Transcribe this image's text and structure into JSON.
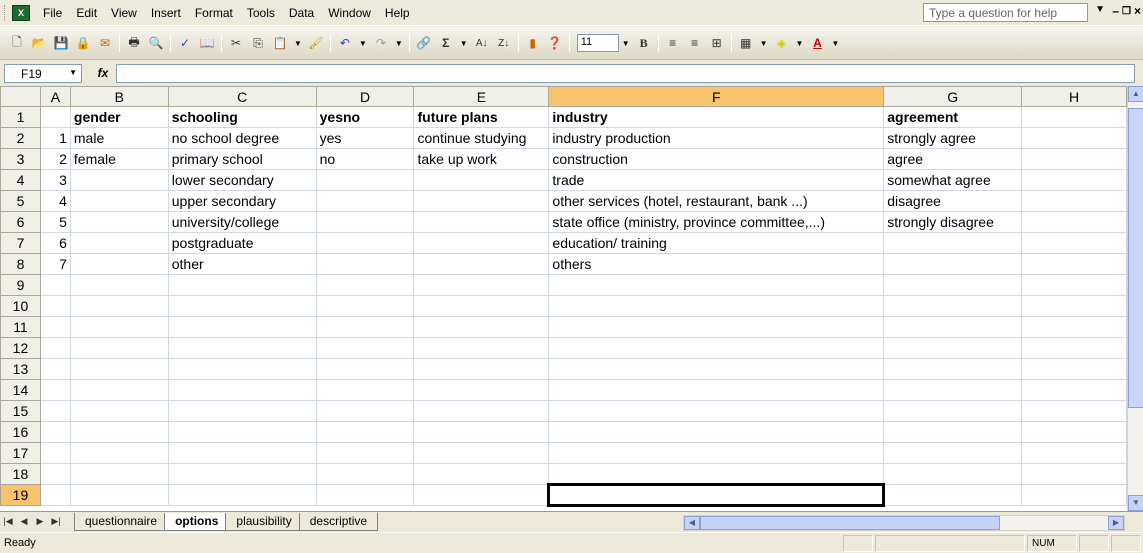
{
  "menu": {
    "items": [
      "File",
      "Edit",
      "View",
      "Insert",
      "Format",
      "Tools",
      "Data",
      "Window",
      "Help"
    ],
    "help_placeholder": "Type a question for help"
  },
  "toolbar": {
    "font_size": "11"
  },
  "formula_bar": {
    "name_box": "F19",
    "fx": "fx",
    "value": ""
  },
  "grid": {
    "columns": [
      "A",
      "B",
      "C",
      "D",
      "E",
      "F",
      "G",
      "H"
    ],
    "active_column": "F",
    "active_row": 19,
    "rows": [
      [
        "",
        "gender",
        "schooling",
        "yesno",
        "future plans",
        "industry",
        "agreement",
        ""
      ],
      [
        "1",
        "male",
        "no school degree",
        "yes",
        "continue studying",
        " industry production",
        "strongly agree",
        ""
      ],
      [
        "2",
        "female",
        "primary school",
        "no",
        "take up work",
        " construction",
        "agree",
        ""
      ],
      [
        "3",
        "",
        "lower secondary",
        "",
        "",
        "trade",
        "somewhat agree",
        ""
      ],
      [
        "4",
        "",
        "upper secondary",
        "",
        "",
        " other services (hotel, restaurant, bank ...)",
        "disagree",
        ""
      ],
      [
        "5",
        "",
        "university/college",
        "",
        "",
        " state office (ministry, province committee,...)",
        "strongly disagree",
        ""
      ],
      [
        "6",
        "",
        "postgraduate",
        "",
        "",
        " education/ training",
        "",
        ""
      ],
      [
        "7",
        "",
        "other",
        "",
        "",
        "others",
        "",
        ""
      ],
      [
        "",
        "",
        "",
        "",
        "",
        "",
        "",
        ""
      ],
      [
        "",
        "",
        "",
        "",
        "",
        "",
        "",
        ""
      ],
      [
        "",
        "",
        "",
        "",
        "",
        "",
        "",
        ""
      ],
      [
        "",
        "",
        "",
        "",
        "",
        "",
        "",
        ""
      ],
      [
        "",
        "",
        "",
        "",
        "",
        "",
        "",
        ""
      ],
      [
        "",
        "",
        "",
        "",
        "",
        "",
        "",
        ""
      ],
      [
        "",
        "",
        "",
        "",
        "",
        "",
        "",
        ""
      ],
      [
        "",
        "",
        "",
        "",
        "",
        "",
        "",
        ""
      ],
      [
        "",
        "",
        "",
        "",
        "",
        "",
        "",
        ""
      ],
      [
        "",
        "",
        "",
        "",
        "",
        "",
        "",
        ""
      ],
      [
        "",
        "",
        "",
        "",
        "",
        "",
        "",
        ""
      ]
    ]
  },
  "sheets": {
    "tabs": [
      "questionnaire",
      "options",
      "plausibility",
      "descriptive"
    ],
    "active": "options"
  },
  "status": {
    "ready": "Ready",
    "num": "NUM"
  }
}
